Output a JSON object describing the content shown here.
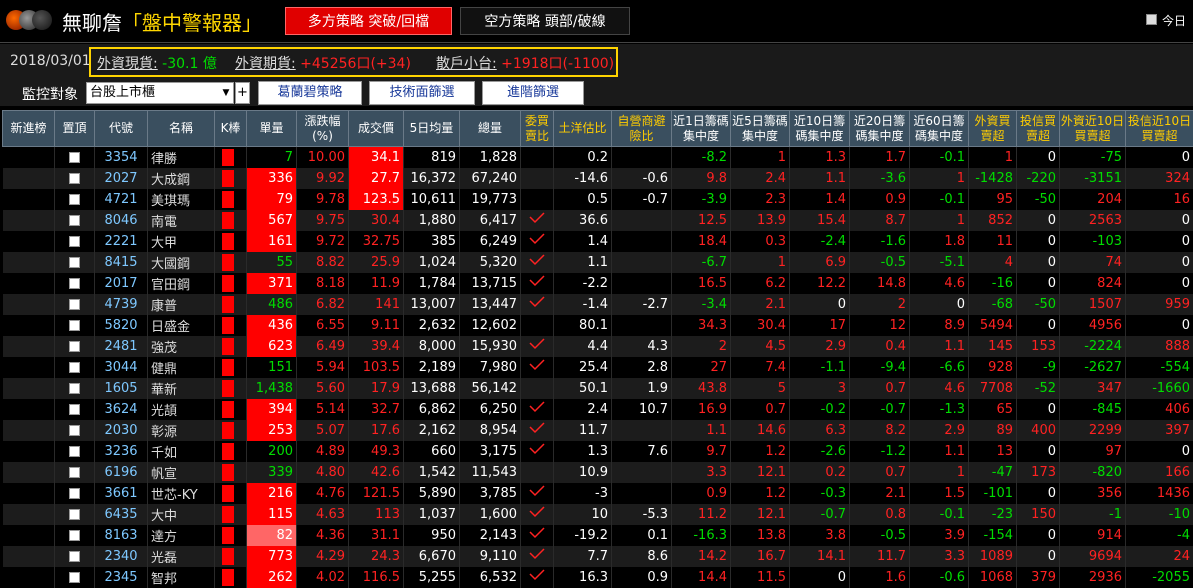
{
  "header": {
    "title_prefix": "無聊詹",
    "title_main": "「盤中警報器」",
    "long_strategy": "多方策略 突破/回檔",
    "short_strategy": "空方策略 頭部/破線",
    "today_label": "今日"
  },
  "info": {
    "date": "2018/03/01",
    "foreign_spot_label": "外資現貨:",
    "foreign_spot_value": "-30.1 億",
    "foreign_futures_label": "外資期貨:",
    "foreign_futures_value": "+45256口(+34)",
    "retail_mini_label": "散戶小台:",
    "retail_mini_value": "+1918口(-1100)"
  },
  "filter": {
    "label": "監控對象",
    "market": "台股上市櫃",
    "plus": "+",
    "btn1": "葛蘭碧策略",
    "btn2": "技術面篩選",
    "btn3": "進階篩選"
  },
  "columns": [
    "新進榜",
    "置頂",
    "代號",
    "名稱",
    "K棒",
    "單量",
    "漲跌幅(%)",
    "成交價",
    "5日均量",
    "總量",
    "委買賣比",
    "土洋估比",
    "自營商避險比",
    "近1日籌碼集中度",
    "近5日籌碼集中度",
    "近10日籌碼集中度",
    "近20日籌碼集中度",
    "近60日籌碼集中度",
    "外資買賣超",
    "投信買賣超",
    "外資近10日買賣超",
    "投信近10日買賣超"
  ],
  "colors": {
    "header_bg": "#3a4f5f",
    "up": "#ff2222",
    "down": "#00dd00",
    "accent": "#ffd400"
  },
  "rows": [
    {
      "code": "3354",
      "name": "律勝",
      "vol": "7",
      "pct": "10.00",
      "price": "34.1",
      "avg5": "819",
      "total": "1,828",
      "mark": false,
      "tuyang": "0.2",
      "zyh": "",
      "d1": "-8.2",
      "d5": "1",
      "d10": "1.3",
      "d20": "1.7",
      "d60": "-0.1",
      "wz": "1",
      "tx": "0",
      "wz10": "-75",
      "tx10": "0",
      "vs": "n",
      "ps": "box"
    },
    {
      "code": "2027",
      "name": "大成鋼",
      "vol": "336",
      "pct": "9.92",
      "price": "27.7",
      "avg5": "16,372",
      "total": "67,240",
      "mark": false,
      "tuyang": "-14.6",
      "zyh": "-0.6",
      "d1": "9.8",
      "d5": "2.4",
      "d10": "1.1",
      "d20": "-3.6",
      "d60": "1",
      "wz": "-1428",
      "tx": "-220",
      "wz10": "-3151",
      "tx10": "324",
      "vs": "r",
      "ps": "box"
    },
    {
      "code": "4721",
      "name": "美琪瑪",
      "vol": "79",
      "pct": "9.78",
      "price": "123.5",
      "avg5": "10,611",
      "total": "19,773",
      "mark": false,
      "tuyang": "0.5",
      "zyh": "-0.7",
      "d1": "-3.9",
      "d5": "2.3",
      "d10": "1.4",
      "d20": "0.9",
      "d60": "-0.1",
      "wz": "95",
      "tx": "-50",
      "wz10": "204",
      "tx10": "16",
      "vs": "r",
      "ps": "box"
    },
    {
      "code": "8046",
      "name": "南電",
      "vol": "567",
      "pct": "9.75",
      "price": "30.4",
      "avg5": "1,880",
      "total": "6,417",
      "mark": true,
      "tuyang": "36.6",
      "zyh": "",
      "d1": "12.5",
      "d5": "13.9",
      "d10": "15.4",
      "d20": "8.7",
      "d60": "1",
      "wz": "852",
      "tx": "0",
      "wz10": "2563",
      "tx10": "0",
      "vs": "r",
      "ps": "n"
    },
    {
      "code": "2221",
      "name": "大甲",
      "vol": "161",
      "pct": "9.72",
      "price": "32.75",
      "avg5": "385",
      "total": "6,249",
      "mark": true,
      "tuyang": "1.4",
      "zyh": "",
      "d1": "18.4",
      "d5": "0.3",
      "d10": "-2.4",
      "d20": "-1.6",
      "d60": "1.8",
      "wz": "11",
      "tx": "0",
      "wz10": "-103",
      "tx10": "0",
      "vs": "r",
      "ps": "n"
    },
    {
      "code": "8415",
      "name": "大國鋼",
      "vol": "55",
      "pct": "8.82",
      "price": "25.9",
      "avg5": "1,024",
      "total": "5,320",
      "mark": true,
      "tuyang": "1.1",
      "zyh": "",
      "d1": "-6.7",
      "d5": "1",
      "d10": "6.9",
      "d20": "-0.5",
      "d60": "-5.1",
      "wz": "4",
      "tx": "0",
      "wz10": "74",
      "tx10": "0",
      "vs": "n",
      "ps": "n"
    },
    {
      "code": "2017",
      "name": "官田鋼",
      "vol": "371",
      "pct": "8.18",
      "price": "11.9",
      "avg5": "1,784",
      "total": "13,715",
      "mark": true,
      "tuyang": "-2.2",
      "zyh": "",
      "d1": "16.5",
      "d5": "6.2",
      "d10": "12.2",
      "d20": "14.8",
      "d60": "4.6",
      "wz": "-16",
      "tx": "0",
      "wz10": "824",
      "tx10": "0",
      "vs": "r",
      "ps": "n"
    },
    {
      "code": "4739",
      "name": "康普",
      "vol": "486",
      "pct": "6.82",
      "price": "141",
      "avg5": "13,007",
      "total": "13,447",
      "mark": true,
      "tuyang": "-1.4",
      "zyh": "-2.7",
      "d1": "-3.4",
      "d5": "2.1",
      "d10": "0",
      "d20": "2",
      "d60": "0",
      "wz": "-68",
      "tx": "-50",
      "wz10": "1507",
      "tx10": "959",
      "vs": "n",
      "ps": "n"
    },
    {
      "code": "5820",
      "name": "日盛金",
      "vol": "436",
      "pct": "6.55",
      "price": "9.11",
      "avg5": "2,632",
      "total": "12,602",
      "mark": false,
      "tuyang": "80.1",
      "zyh": "",
      "d1": "34.3",
      "d5": "30.4",
      "d10": "17",
      "d20": "12",
      "d60": "8.9",
      "wz": "5494",
      "tx": "0",
      "wz10": "4956",
      "tx10": "0",
      "vs": "r",
      "ps": "n"
    },
    {
      "code": "2481",
      "name": "強茂",
      "vol": "623",
      "pct": "6.49",
      "price": "39.4",
      "avg5": "8,000",
      "total": "15,930",
      "mark": true,
      "tuyang": "4.4",
      "zyh": "4.3",
      "d1": "2",
      "d5": "4.5",
      "d10": "2.9",
      "d20": "0.4",
      "d60": "1.1",
      "wz": "145",
      "tx": "153",
      "wz10": "-2224",
      "tx10": "888",
      "vs": "r",
      "ps": "n"
    },
    {
      "code": "3044",
      "name": "健鼎",
      "vol": "151",
      "pct": "5.94",
      "price": "103.5",
      "avg5": "2,189",
      "total": "7,980",
      "mark": true,
      "tuyang": "25.4",
      "zyh": "2.8",
      "d1": "27",
      "d5": "7.4",
      "d10": "-1.1",
      "d20": "-9.4",
      "d60": "-6.6",
      "wz": "928",
      "tx": "-9",
      "wz10": "-2627",
      "tx10": "-554",
      "vs": "n",
      "ps": "n"
    },
    {
      "code": "1605",
      "name": "華新",
      "vol": "1,438",
      "pct": "5.60",
      "price": "17.9",
      "avg5": "13,688",
      "total": "56,142",
      "mark": false,
      "tuyang": "50.1",
      "zyh": "1.9",
      "d1": "43.8",
      "d5": "5",
      "d10": "3",
      "d20": "0.7",
      "d60": "4.6",
      "wz": "7708",
      "tx": "-52",
      "wz10": "347",
      "tx10": "-1660",
      "vs": "n",
      "ps": "n"
    },
    {
      "code": "3624",
      "name": "光頡",
      "vol": "394",
      "pct": "5.14",
      "price": "32.7",
      "avg5": "6,862",
      "total": "6,250",
      "mark": true,
      "tuyang": "2.4",
      "zyh": "10.7",
      "d1": "16.9",
      "d5": "0.7",
      "d10": "-0.2",
      "d20": "-0.7",
      "d60": "-1.3",
      "wz": "65",
      "tx": "0",
      "wz10": "-845",
      "tx10": "406",
      "vs": "r",
      "ps": "n"
    },
    {
      "code": "2030",
      "name": "彰源",
      "vol": "253",
      "pct": "5.07",
      "price": "17.6",
      "avg5": "2,162",
      "total": "8,954",
      "mark": true,
      "tuyang": "11.7",
      "zyh": "",
      "d1": "1.1",
      "d5": "14.6",
      "d10": "6.3",
      "d20": "8.2",
      "d60": "2.9",
      "wz": "89",
      "tx": "400",
      "wz10": "2299",
      "tx10": "397",
      "vs": "r",
      "ps": "n"
    },
    {
      "code": "3236",
      "name": "千如",
      "vol": "200",
      "pct": "4.89",
      "price": "49.3",
      "avg5": "660",
      "total": "3,175",
      "mark": true,
      "tuyang": "1.3",
      "zyh": "7.6",
      "d1": "9.7",
      "d5": "1.2",
      "d10": "-2.6",
      "d20": "-1.2",
      "d60": "1.1",
      "wz": "13",
      "tx": "0",
      "wz10": "97",
      "tx10": "0",
      "vs": "n",
      "ps": "n"
    },
    {
      "code": "6196",
      "name": "帆宣",
      "vol": "339",
      "pct": "4.80",
      "price": "42.6",
      "avg5": "1,542",
      "total": "11,543",
      "mark": false,
      "tuyang": "10.9",
      "zyh": "",
      "d1": "3.3",
      "d5": "12.1",
      "d10": "0.2",
      "d20": "0.7",
      "d60": "1",
      "wz": "-47",
      "tx": "173",
      "wz10": "-820",
      "tx10": "166",
      "vs": "n",
      "ps": "n"
    },
    {
      "code": "3661",
      "name": "世芯-KY",
      "vol": "216",
      "pct": "4.76",
      "price": "121.5",
      "avg5": "5,890",
      "total": "3,785",
      "mark": true,
      "tuyang": "-3",
      "zyh": "",
      "d1": "0.9",
      "d5": "1.2",
      "d10": "-0.3",
      "d20": "2.1",
      "d60": "1.5",
      "wz": "-101",
      "tx": "0",
      "wz10": "356",
      "tx10": "1436",
      "vs": "r",
      "ps": "n"
    },
    {
      "code": "6435",
      "name": "大中",
      "vol": "115",
      "pct": "4.63",
      "price": "113",
      "avg5": "1,037",
      "total": "1,600",
      "mark": true,
      "tuyang": "10",
      "zyh": "-5.3",
      "d1": "11.2",
      "d5": "12.1",
      "d10": "-0.7",
      "d20": "0.8",
      "d60": "-0.1",
      "wz": "-23",
      "tx": "150",
      "wz10": "-1",
      "tx10": "-10",
      "vs": "r",
      "ps": "n"
    },
    {
      "code": "8163",
      "name": "達方",
      "vol": "82",
      "pct": "4.36",
      "price": "31.1",
      "avg5": "950",
      "total": "2,143",
      "mark": true,
      "tuyang": "-19.2",
      "zyh": "0.1",
      "d1": "-16.3",
      "d5": "13.8",
      "d10": "3.8",
      "d20": "-0.5",
      "d60": "3.9",
      "wz": "-154",
      "tx": "0",
      "wz10": "914",
      "tx10": "-4",
      "vs": "p",
      "ps": "n"
    },
    {
      "code": "2340",
      "name": "光磊",
      "vol": "773",
      "pct": "4.29",
      "price": "24.3",
      "avg5": "6,670",
      "total": "9,110",
      "mark": true,
      "tuyang": "7.7",
      "zyh": "8.6",
      "d1": "14.2",
      "d5": "16.7",
      "d10": "14.1",
      "d20": "11.7",
      "d60": "3.3",
      "wz": "1089",
      "tx": "0",
      "wz10": "9694",
      "tx10": "24",
      "vs": "r",
      "ps": "n"
    },
    {
      "code": "2345",
      "name": "智邦",
      "vol": "262",
      "pct": "4.02",
      "price": "116.5",
      "avg5": "5,255",
      "total": "6,532",
      "mark": true,
      "tuyang": "16.3",
      "zyh": "0.9",
      "d1": "14.4",
      "d5": "11.5",
      "d10": "0",
      "d20": "1.6",
      "d60": "-0.6",
      "wz": "1068",
      "tx": "379",
      "wz10": "2936",
      "tx10": "-2055",
      "vs": "r",
      "ps": "n"
    }
  ]
}
